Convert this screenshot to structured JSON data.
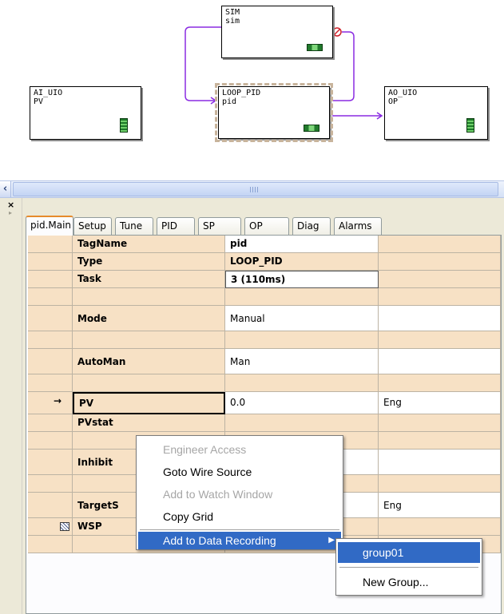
{
  "diagram": {
    "blocks": [
      {
        "type": "SIM",
        "name": "sim"
      },
      {
        "type": "AI_UIO",
        "name": "PV"
      },
      {
        "type": "LOOP_PID",
        "name": "pid"
      },
      {
        "type": "AO_UIO",
        "name": "OP"
      }
    ],
    "colors": {
      "wire": "#8a2be2",
      "selection_hatch": "#c8b49c"
    }
  },
  "tabs": [
    "pid.Main",
    "Setup",
    "Tune",
    "PID",
    "SP",
    "OP",
    "Diag",
    "Alarms"
  ],
  "active_tab": "pid.Main",
  "grid": {
    "rows": [
      {
        "name": "TagName",
        "value": "pid",
        "extra": ""
      },
      {
        "name": "Type",
        "value": "LOOP_PID",
        "extra": ""
      },
      {
        "name": "Task",
        "value": "3  (110ms)",
        "extra": ""
      },
      {
        "name": "",
        "value": "",
        "extra": ""
      },
      {
        "name": "Mode",
        "value": "Manual",
        "extra": ""
      },
      {
        "name": "",
        "value": "",
        "extra": ""
      },
      {
        "name": "AutoMan",
        "value": "Man",
        "extra": ""
      },
      {
        "name": "",
        "value": "",
        "extra": ""
      },
      {
        "name": "PV",
        "value": "0.0",
        "extra": "Eng"
      },
      {
        "name": "PVstat",
        "value": "",
        "extra": ""
      },
      {
        "name": "",
        "value": "",
        "extra": ""
      },
      {
        "name": "Inhibit",
        "value": "",
        "extra": ""
      },
      {
        "name": "",
        "value": "",
        "extra": ""
      },
      {
        "name": "TargetS",
        "value": "",
        "extra": "Eng"
      },
      {
        "name": "WSP",
        "value": "",
        "extra": ""
      },
      {
        "name": "",
        "value": "",
        "extra": ""
      }
    ],
    "colors": {
      "row_bg": "#f7e1c5",
      "value_bg": "#ffffff"
    }
  },
  "context_menu": {
    "items": [
      {
        "label": "Engineer Access",
        "enabled": false
      },
      {
        "label": "Goto Wire Source",
        "enabled": true
      },
      {
        "label": "Add to Watch Window",
        "enabled": false
      },
      {
        "label": "Copy Grid",
        "enabled": true
      },
      {
        "label": "Add to Data Recording",
        "enabled": true,
        "submenu": true
      }
    ],
    "highlight_color": "#316ac5"
  },
  "submenu": {
    "items": [
      {
        "label": "group01"
      },
      {
        "label": "New Group..."
      }
    ]
  }
}
